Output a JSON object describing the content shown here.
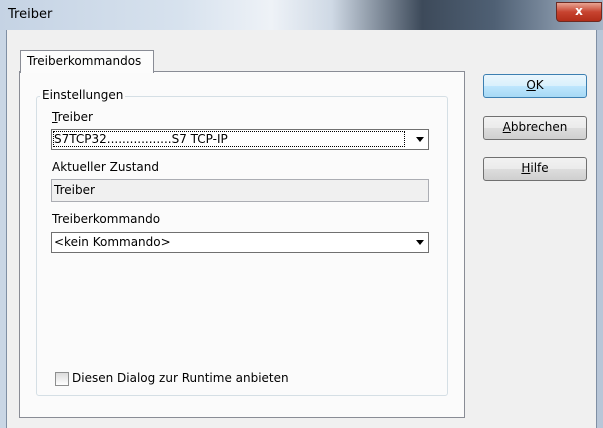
{
  "window": {
    "title": "Treiber",
    "close_label": "x"
  },
  "tabs": [
    {
      "label": "Treiberkommandos"
    }
  ],
  "group": {
    "legend": "Einstellungen"
  },
  "driver": {
    "label_accel": "T",
    "label_rest": "reiber",
    "value": "S7TCP32.................S7 TCP-IP"
  },
  "state": {
    "label": "Aktueller Zustand",
    "value": "Treiber"
  },
  "command": {
    "label": "Treiberkommando",
    "value": "<kein Kommando>"
  },
  "runtime_checkbox": {
    "label": "Diesen Dialog zur Runtime anbieten",
    "checked": false
  },
  "buttons": {
    "ok": {
      "accel": "O",
      "rest": "K"
    },
    "cancel": {
      "accel": "A",
      "rest": "bbrechen"
    },
    "help": {
      "accel": "H",
      "rest": "ilfe"
    }
  }
}
